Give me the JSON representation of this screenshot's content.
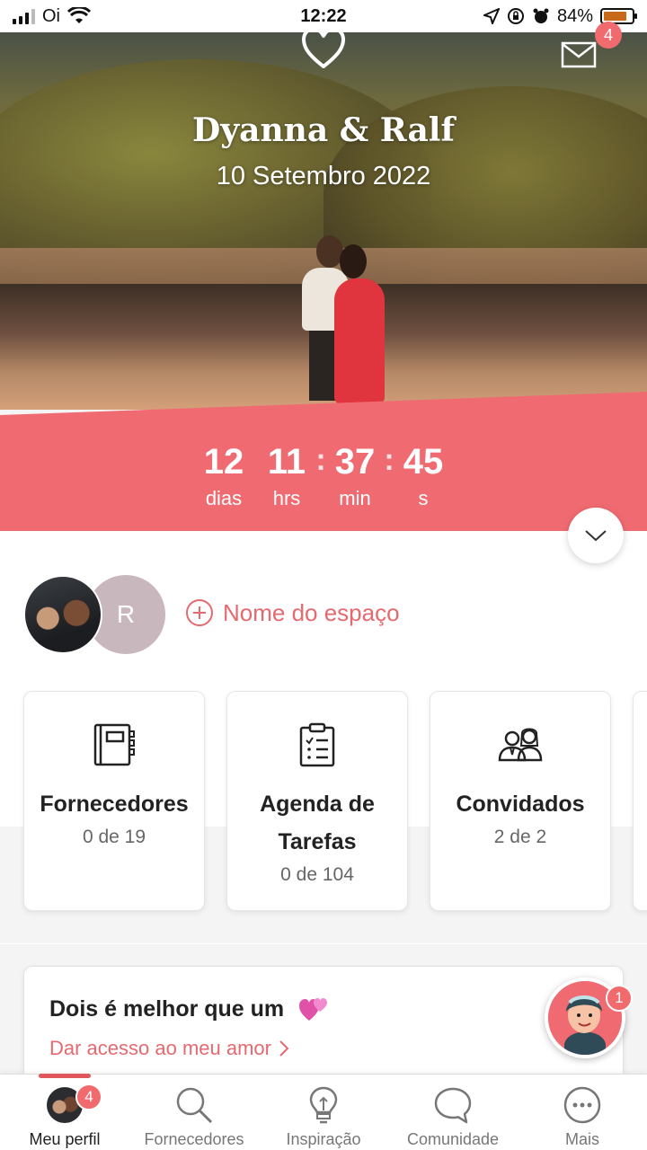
{
  "status_bar": {
    "carrier": "Oi",
    "time": "12:22",
    "battery": "84%",
    "battery_level": 0.84
  },
  "header": {
    "couple_name": "Dyanna & Ralf",
    "wedding_date": "10 Setembro 2022",
    "messages_badge": "4"
  },
  "countdown": [
    {
      "value": "12",
      "label": "dias"
    },
    {
      "value": "11",
      "label": "hrs"
    },
    {
      "value": "37",
      "label": "min"
    },
    {
      "value": "45",
      "label": "s"
    }
  ],
  "profile": {
    "partner_initial": "R",
    "add_space_label": "Nome do espaço"
  },
  "cards": [
    {
      "title": "Fornecedores",
      "count": "0 de 19",
      "icon": "notebook-icon"
    },
    {
      "title": "Agenda de Tarefas",
      "count": "0 de 104",
      "icon": "checklist-icon"
    },
    {
      "title": "Convidados",
      "count": "2 de 2",
      "icon": "guests-icon"
    }
  ],
  "promo": {
    "title": "Dois é melhor que um",
    "link": "Dar acesso ao meu amor"
  },
  "helper_badge": "1",
  "bottom_nav": [
    {
      "label": "Meu perfil",
      "icon": "avatar-icon",
      "badge": "4",
      "active": true
    },
    {
      "label": "Fornecedores",
      "icon": "search-icon"
    },
    {
      "label": "Inspiração",
      "icon": "lightbulb-icon"
    },
    {
      "label": "Comunidade",
      "icon": "chat-bubble-icon"
    },
    {
      "label": "Mais",
      "icon": "more-icon"
    }
  ],
  "colors": {
    "accent": "#f06b71",
    "link": "#e56a70"
  }
}
